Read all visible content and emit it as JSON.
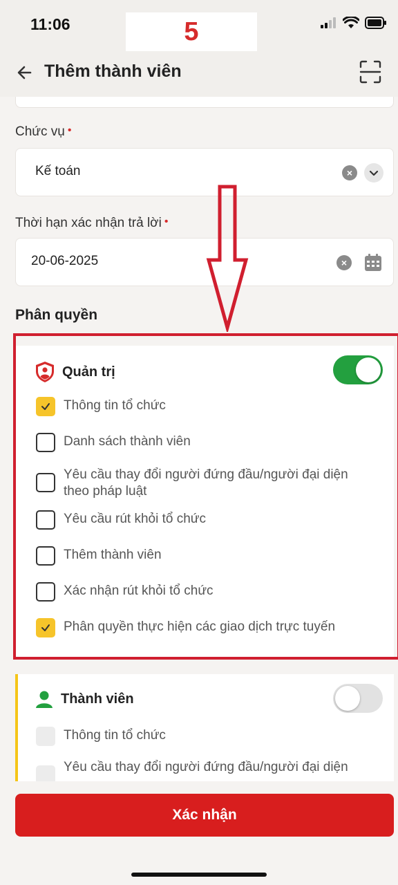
{
  "status_bar": {
    "time": "11:06",
    "step": "5"
  },
  "header": {
    "title": "Thêm thành viên"
  },
  "form": {
    "position_label": "Chức vụ",
    "position_value": "Kế toán",
    "deadline_label": "Thời hạn xác nhận trả lời",
    "deadline_value": "20-06-2025",
    "required_mark": "•"
  },
  "permissions": {
    "section_title": "Phân quyền",
    "admin": {
      "title": "Quản trị",
      "enabled": true,
      "items": [
        {
          "label": "Thông tin tổ chức",
          "checked": true
        },
        {
          "label": "Danh sách thành viên",
          "checked": false
        },
        {
          "label": "Yêu cầu thay đổi người đứng đầu/người đại diện theo pháp luật",
          "checked": false
        },
        {
          "label": "Yêu cầu rút khỏi tổ chức",
          "checked": false
        },
        {
          "label": "Thêm thành viên",
          "checked": false
        },
        {
          "label": "Xác nhận rút khỏi tổ chức",
          "checked": false
        },
        {
          "label": "Phân quyền thực hiện các giao dịch trực tuyến",
          "checked": true
        }
      ]
    },
    "member": {
      "title": "Thành viên",
      "enabled": false,
      "items": [
        {
          "label": "Thông tin tổ chức",
          "checked": false
        },
        {
          "label": "Yêu cầu thay đổi người đứng đầu/người đại diện",
          "checked": false
        }
      ]
    }
  },
  "confirm_label": "Xác nhận",
  "colors": {
    "accent": "#d81e1e",
    "toggle_on": "#23a03f",
    "check": "#f6c42a",
    "highlight": "#d01f2f"
  }
}
